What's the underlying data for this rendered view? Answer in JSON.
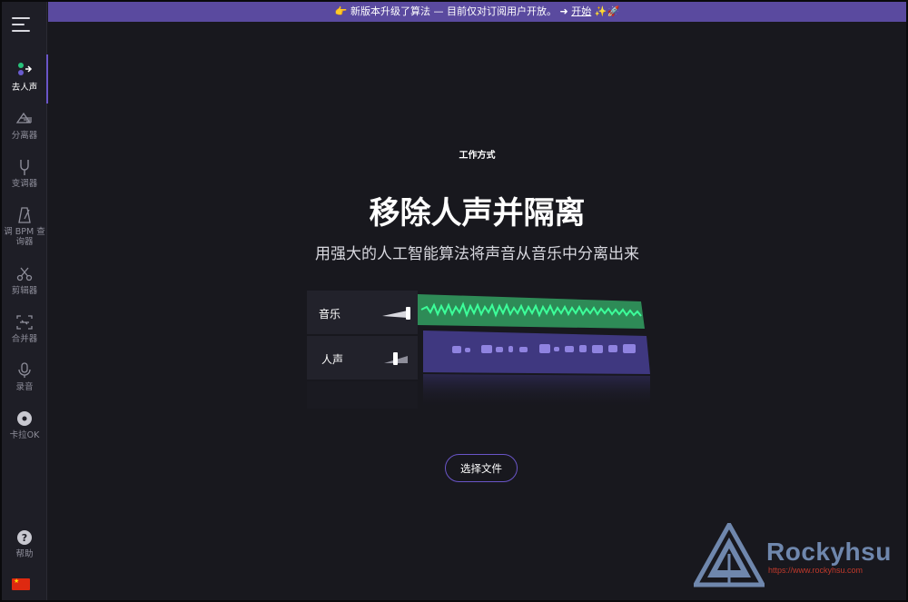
{
  "banner": {
    "text": "👉 新版本升级了算法 — 目前仅对订阅用户开放。 ➜ ",
    "link": "开始",
    "trail": " ✨🚀"
  },
  "sidebar": {
    "items": [
      {
        "label": "去人声",
        "icon": "vocal-remover-icon",
        "active": true
      },
      {
        "label": "分离器",
        "icon": "splitter-icon",
        "active": false
      },
      {
        "label": "变调器",
        "icon": "tuning-fork-icon",
        "active": false
      },
      {
        "label": "调 BPM 查询器",
        "icon": "metronome-icon",
        "active": false
      },
      {
        "label": "剪辑器",
        "icon": "scissors-icon",
        "active": false
      },
      {
        "label": "合并器",
        "icon": "joiner-icon",
        "active": false
      },
      {
        "label": "录音",
        "icon": "microphone-icon",
        "active": false
      },
      {
        "label": "卡拉OK",
        "icon": "disc-icon",
        "active": false
      }
    ],
    "help": "帮助",
    "language": "china-flag-icon"
  },
  "main": {
    "kicker": "工作方式",
    "title": "移除人声并隔离",
    "subtitle": "用强大的人工智能算法将声音从音乐中分离出来",
    "tracks": [
      {
        "label": "音乐",
        "color": "#1fd17a"
      },
      {
        "label": "人声",
        "color": "#6a5ccf"
      }
    ],
    "select_button": "选择文件"
  },
  "watermark": {
    "name": "Rockyhsu",
    "url": "https://www.rockyhsu.com"
  },
  "colors": {
    "accent": "#6a55c8",
    "banner": "#5a4a9f",
    "background": "#18181e",
    "sidebar": "#1e1e26"
  }
}
